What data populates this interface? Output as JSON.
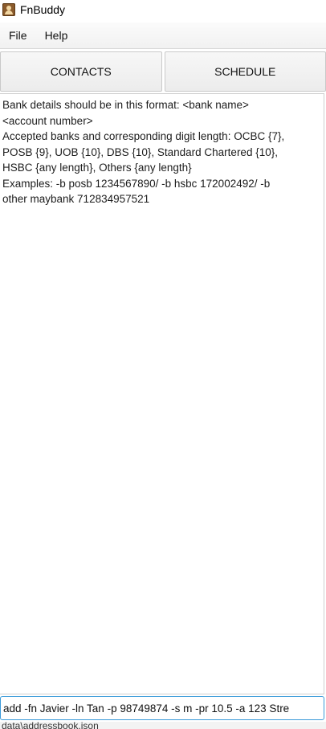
{
  "window": {
    "title": "FnBuddy",
    "icon": "address-book-icon"
  },
  "menu": {
    "file": "File",
    "help": "Help"
  },
  "tabs": {
    "contacts": "CONTACTS",
    "schedule": "SCHEDULE"
  },
  "result": {
    "text": "Bank details should be in this format: <bank name>\n<account number>\nAccepted banks and corresponding digit length: OCBC {7},\nPOSB {9}, UOB {10}, DBS {10}, Standard Chartered {10},\nHSBC {any length}, Others {any length}\nExamples: -b posb 1234567890/ -b hsbc 172002492/ -b\nother maybank 712834957521"
  },
  "command": {
    "value": "add -fn Javier -ln Tan -p 98749874 -s m -pr 10.5 -a 123 Stre"
  },
  "status": {
    "path": "data\\addressbook.json"
  },
  "colors": {
    "focus_border": "#3a9ad9",
    "tab_background": "#ececec"
  }
}
